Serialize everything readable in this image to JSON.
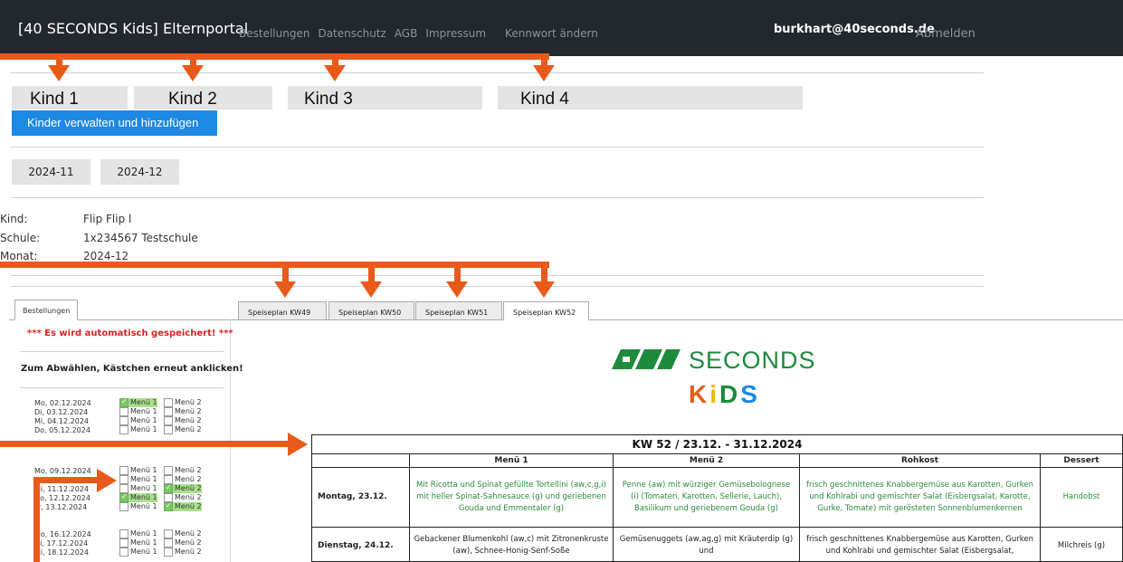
{
  "header": {
    "brand": "[40 SECONDS Kids] Elternportal",
    "nav": [
      "Bestellungen",
      "Datenschutz",
      "AGB",
      "Impressum",
      "Kennwort ändern"
    ],
    "user": "burkhart@40seconds.de",
    "logout": "Abmelden"
  },
  "kids": {
    "tabs": [
      "Kind 1",
      "Kind 2",
      "Kind 3",
      "Kind 4"
    ],
    "manage_button": "Kinder verwalten und hinzufügen"
  },
  "months": [
    "2024-11",
    "2024-12"
  ],
  "info": {
    "kind_label": "Kind:",
    "kind_value": "Flip Flip l",
    "schule_label": "Schule:",
    "schule_value": "1x234567 Testschule",
    "monat_label": "Monat:",
    "monat_value": "2024-12"
  },
  "orders": {
    "tab": "Bestellungen",
    "autosave": "*** Es wird automatisch gespeichert! ***",
    "deselect_hint": "Zum Abwählen, Kästchen erneut anklicken!",
    "menu1_label": "Menü 1",
    "menu2_label": "Menü 2",
    "rows": [
      {
        "date": "Mo, 02.12.2024",
        "m1": true,
        "m2": false
      },
      {
        "date": "Di, 03.12.2024",
        "m1": false,
        "m2": false
      },
      {
        "date": "Mi, 04.12.2024",
        "m1": false,
        "m2": false
      },
      {
        "date": "Do, 05.12.2024",
        "m1": false,
        "m2": false
      },
      {
        "date": "Mo, 09.12.2024",
        "m1": false,
        "m2": false
      },
      {
        "date": "Di, 10.12.2024",
        "m1": false,
        "m2": false
      },
      {
        "date": "Mi, 11.12.2024",
        "m1": false,
        "m2": true
      },
      {
        "date": "Do, 12.12.2024",
        "m1": true,
        "m2": false
      },
      {
        "date": "Fr, 13.12.2024",
        "m1": false,
        "m2": true
      },
      {
        "date": "Mo, 16.12.2024",
        "m1": false,
        "m2": false
      },
      {
        "date": "Di, 17.12.2024",
        "m1": false,
        "m2": false
      },
      {
        "date": "Mi, 18.12.2024",
        "m1": false,
        "m2": false
      }
    ]
  },
  "menu_tabs": [
    "Speiseplan KW49",
    "Speiseplan KW50",
    "Speiseplan KW51",
    "Speiseplan KW52"
  ],
  "logo": {
    "text": "SECONDS",
    "kids": "KIDS"
  },
  "plan": {
    "title": "KW 52   /   23.12. - 31.12.2024",
    "columns": [
      "Menü 1",
      "Menü 2",
      "Rohkost",
      "Dessert"
    ],
    "rows": [
      {
        "day": "Montag, 23.12.",
        "menu1": "Mit Ricotta und Spinat gefüllte Tortellini (aw,c,g,i) mit heller Spinat-Sahnesauce (g) und geriebenen Gouda und Emmentaler (g)",
        "menu2": "Penne (aw) mit würziger Gemüsebolognese (i) (Tomaten, Karotten, Sellerie, Lauch), Basilikum und geriebenem Gouda (g)",
        "rohkost": "frisch geschnittenes Knabbergemüse aus Karotten, Gurken und Kohlrabi und gemischter Salat (Eisbergsalat, Karotte, Gurke, Tomate) mit gerösteten Sonnenblumenkernen",
        "dessert": "Handobst"
      },
      {
        "day": "Dienstag, 24.12.",
        "menu1": "Gebackener Blumenkohl (aw,c) mit Zitronenkruste (aw), Schnee-Honig-Senf-Soße",
        "menu2": "Gemüsenuggets (aw,ag,g) mit Kräuterdip (g) und",
        "rohkost": "frisch geschnittenes Knabbergemüse aus Karotten, Gurken und Kohlrabi und gemischter Salat (Eisbergsalat,",
        "dessert": "Milchreis (g)"
      }
    ]
  },
  "colors": {
    "topbar": "#23272e",
    "accent": "#1e88e5",
    "arrow": "#e85a1a",
    "menu_green": "#2a8a3a",
    "logo_green": "#1e8a3c",
    "alert": "#e02020"
  }
}
